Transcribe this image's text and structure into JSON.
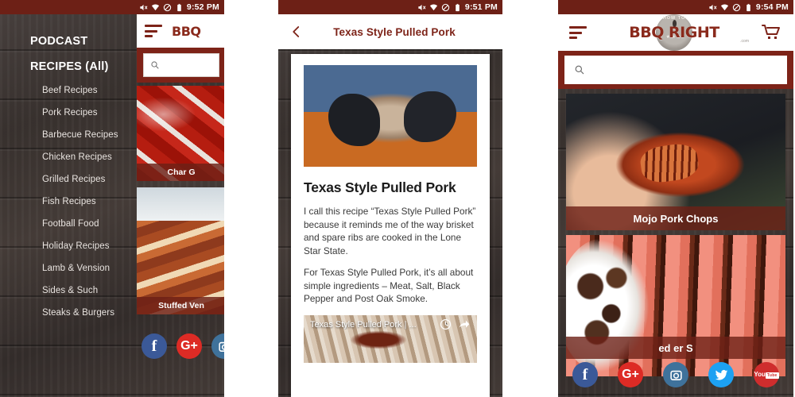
{
  "app": {
    "name": "HowToBBQRight"
  },
  "brand": {
    "accent": "#7d2318",
    "statusbar": "#6d2016",
    "caption_overlay": "#6d2016",
    "logo_text": "BBQ RIGHT",
    "logo_badge_top": "HOW TO",
    "logo_badge_stars": "★★★",
    "logo_suffix": ".com"
  },
  "panels": [
    {
      "id": "left",
      "status_bar": {
        "time": "9:52 PM",
        "icons": [
          "mute-icon",
          "wifi-icon",
          "do-not-disturb-icon",
          "battery-icon"
        ]
      },
      "drawer": {
        "headings": [
          "PODCAST",
          "RECIPES (All)"
        ],
        "items": [
          "Beef Recipes",
          "Pork Recipes",
          "Barbecue Recipes",
          "Chicken Recipes",
          "Grilled Recipes",
          "Fish Recipes",
          "Football Food",
          "Holiday Recipes",
          "Lamb & Vension",
          "Sides & Such",
          "Steaks & Burgers"
        ]
      },
      "under_app": {
        "menu_icon": "hamburger-icon",
        "logo_partial": "BBQ",
        "search_placeholder": "",
        "search_value": "",
        "cards": [
          {
            "caption": "Char G",
            "photo": "ribs-photo"
          },
          {
            "caption": "Stuffed Ven",
            "photo": "bacon-wrapped-venison-photo"
          }
        ]
      },
      "social": [
        "facebook-icon",
        "google-plus-icon",
        "instagram-icon"
      ]
    },
    {
      "id": "middle",
      "status_bar": {
        "time": "9:51 PM",
        "icons": [
          "mute-icon",
          "wifi-icon",
          "do-not-disturb-icon",
          "battery-icon"
        ]
      },
      "topbar": {
        "back_icon": "back-chevron-icon",
        "title": "Texas Style Pulled Pork"
      },
      "article": {
        "hero_photo": "pulled-pork-hands-photo",
        "heading": "Texas Style Pulled Pork",
        "paragraphs": [
          "I call this recipe “Texas Style Pulled Pork” because it reminds me of the way brisket and spare ribs are cooked in the Lone Star State.",
          "For Texas Style Pulled Pork, it’s all about simple ingredients – Meat, Salt, Black Pepper and Post Oak Smoke."
        ],
        "video": {
          "title": "Texas Style Pulled Pork | ...",
          "watch_later_icon": "clock-icon",
          "share_icon": "share-arrow-icon"
        }
      }
    },
    {
      "id": "right",
      "status_bar": {
        "time": "9:54 PM",
        "icons": [
          "mute-icon",
          "wifi-icon",
          "do-not-disturb-icon",
          "battery-icon"
        ]
      },
      "topbar": {
        "menu_icon": "hamburger-icon",
        "cart_icon": "shopping-cart-icon"
      },
      "search": {
        "placeholder": "",
        "value": "",
        "icon": "search-icon"
      },
      "cards": [
        {
          "caption": "Mojo Pork Chops",
          "photo": "mojo-pork-chop-photo"
        },
        {
          "caption": "ed           er S",
          "photo": "sliced-steak-photo"
        }
      ],
      "social": [
        "facebook-icon",
        "google-plus-icon",
        "instagram-icon",
        "twitter-icon",
        "youtube-icon"
      ]
    }
  ]
}
